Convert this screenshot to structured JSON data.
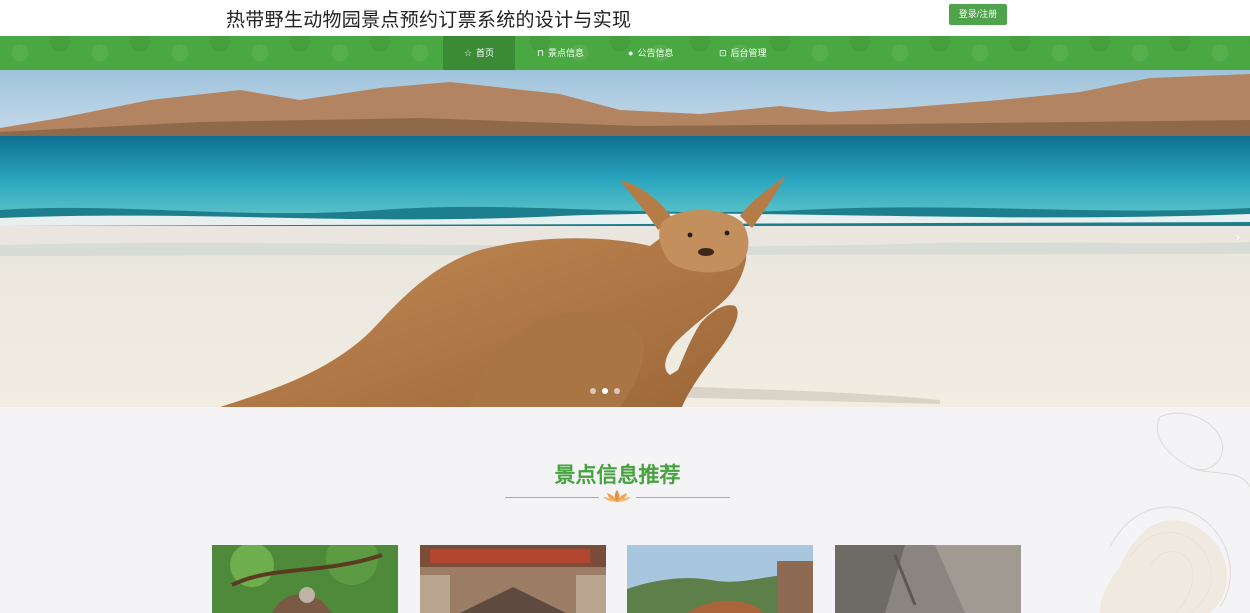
{
  "header": {
    "site_title": "热带野生动物园景点预约订票系统的设计与实现",
    "login_label": "登录/注册"
  },
  "nav": {
    "items": [
      {
        "icon": "star-icon",
        "label": "首页"
      },
      {
        "icon": "bag-icon",
        "label": "景点信息"
      },
      {
        "icon": "circle-icon",
        "label": "公告信息"
      },
      {
        "icon": "box-icon",
        "label": "后台管理"
      }
    ]
  },
  "banner": {
    "next_glyph": "›",
    "slide_count": 3,
    "active_slide": 1
  },
  "section": {
    "title": "景点信息推荐"
  },
  "colors": {
    "brand_green": "#4aa842",
    "title_green": "#46a23f",
    "deco_orange": "#e49d55"
  }
}
